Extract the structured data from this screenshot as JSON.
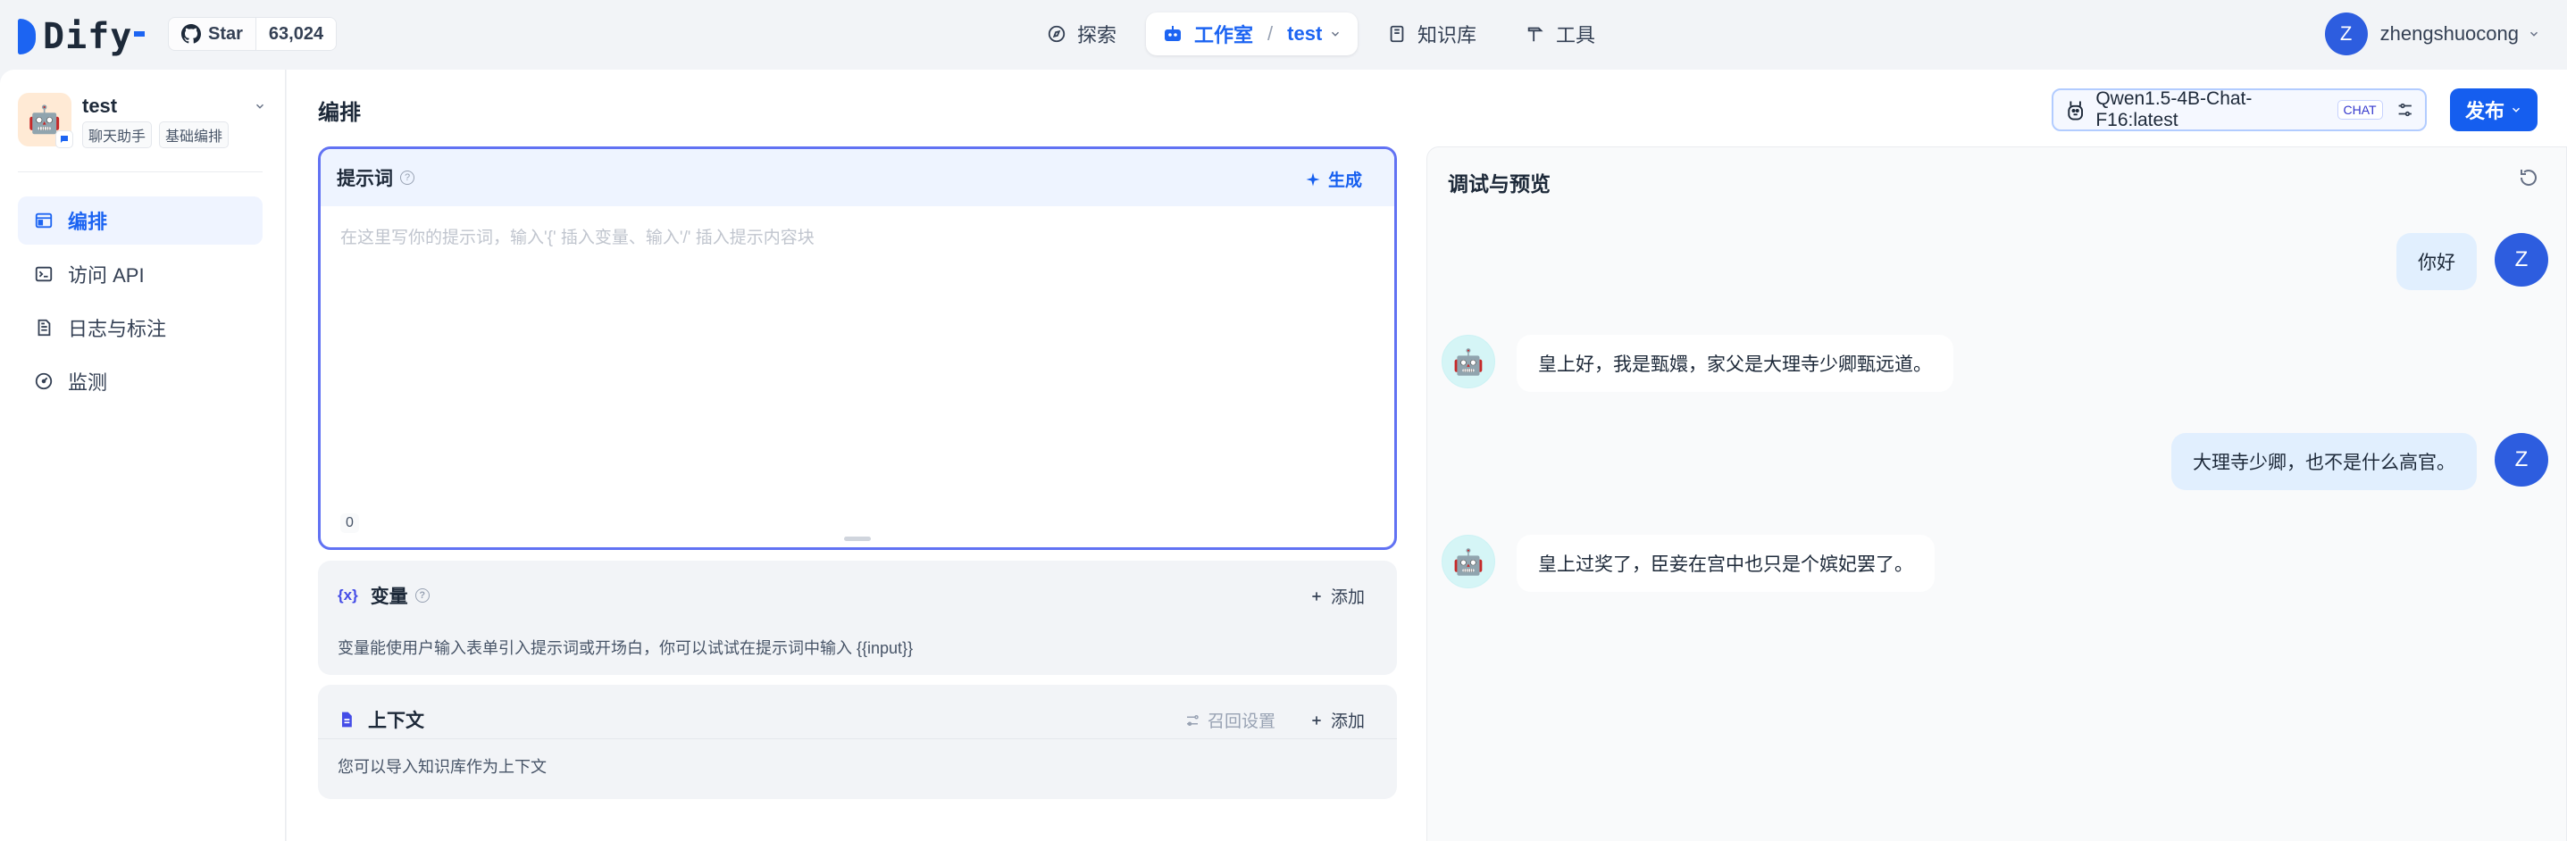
{
  "brand": {
    "name": "Dify"
  },
  "github": {
    "star_label": "Star",
    "count": "63,024"
  },
  "nav": {
    "explore": "探索",
    "studio": "工作室",
    "separator": "/",
    "studio_app": "test",
    "knowledge": "知识库",
    "tools": "工具"
  },
  "user": {
    "initial": "Z",
    "name": "zhengshuocong"
  },
  "app": {
    "name": "test",
    "emoji": "🤖",
    "tag_type": "聊天助手",
    "tag_mode": "基础编排"
  },
  "sidebar": {
    "items": [
      {
        "label": "编排",
        "icon": "layout-icon",
        "active": true
      },
      {
        "label": "访问 API",
        "icon": "terminal-icon",
        "active": false
      },
      {
        "label": "日志与标注",
        "icon": "file-list-icon",
        "active": false
      },
      {
        "label": "监测",
        "icon": "dashboard-icon",
        "active": false
      }
    ]
  },
  "header": {
    "title": "编排",
    "model_name": "Qwen1.5-4B-Chat-F16:latest",
    "model_mode": "CHAT",
    "publish_label": "发布"
  },
  "prompt": {
    "title": "提示词",
    "generate_label": "生成",
    "placeholder": "在这里写你的提示词，输入'{' 插入变量、输入'/' 插入提示内容块",
    "char_count": "0"
  },
  "variables": {
    "icon_text": "{x}",
    "title": "变量",
    "add_label": "添加",
    "description": "变量能使用户输入表单引入提示词或开场白，你可以试试在提示词中输入 {{input}}"
  },
  "context": {
    "title": "上下文",
    "recall_label": "召回设置",
    "add_label": "添加",
    "description": "您可以导入知识库作为上下文"
  },
  "debug": {
    "title": "调试与预览",
    "messages": [
      {
        "role": "user",
        "text": "你好"
      },
      {
        "role": "bot",
        "text": "皇上好，我是甄嬛，家父是大理寺少卿甄远道。"
      },
      {
        "role": "user",
        "text": "大理寺少卿，也不是什么高官。"
      },
      {
        "role": "bot",
        "text": "皇上过奖了，臣妾在宫中也只是个嫔妃罢了。"
      }
    ]
  },
  "colors": {
    "accent": "#155eef",
    "prompt_border": "#6172f3",
    "user_bubble": "#e1effe"
  }
}
